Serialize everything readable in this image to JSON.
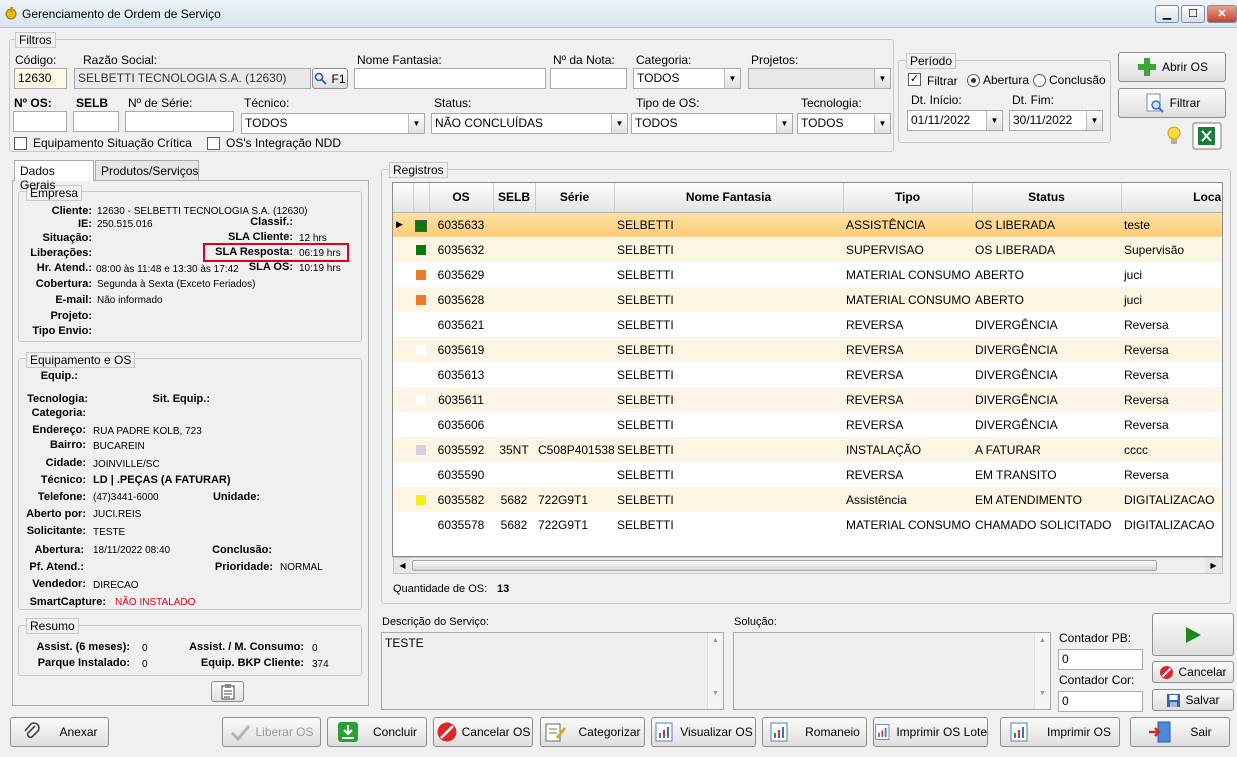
{
  "window": {
    "title": "Gerenciamento de Ordem de Serviço",
    "min_glyph": "▁",
    "max_glyph": "☐",
    "close_glyph": "✕"
  },
  "filters": {
    "legend": "Filtros",
    "codigo": {
      "label": "Código:",
      "value": "12630"
    },
    "razao_social": {
      "label": "Razão Social:",
      "value": "SELBETTI TECNOLOGIA S.A. (12630)"
    },
    "f1_button": "F1",
    "nome_fantasia": {
      "label": "Nome Fantasia:",
      "value": ""
    },
    "nota": {
      "label": "Nº da Nota:",
      "value": ""
    },
    "categoria": {
      "label": "Categoria:",
      "value": "TODOS"
    },
    "projetos": {
      "label": "Projetos:",
      "value": ""
    },
    "num_os": {
      "label": "Nº OS:",
      "value": ""
    },
    "selb": {
      "label": "SELB",
      "value": ""
    },
    "serie": {
      "label": "Nº de Série:",
      "value": ""
    },
    "tecnico": {
      "label": "Técnico:",
      "value": "TODOS"
    },
    "status": {
      "label": "Status:",
      "value": "NÃO CONCLUÍDAS"
    },
    "tipo_os": {
      "label": "Tipo de OS:",
      "value": "TODOS"
    },
    "tecnologia": {
      "label": "Tecnologia:",
      "value": "TODOS"
    },
    "equip_critica": "Equipamento Situação Crítica",
    "integracao_ndd": "OS's Integração NDD"
  },
  "periodo": {
    "legend": "Período",
    "filtrar": "Filtrar",
    "abertura": "Abertura",
    "conclusao": "Conclusão",
    "dt_inicio_label": "Dt. Início:",
    "dt_inicio": "01/11/2022",
    "dt_fim_label": "Dt. Fim:",
    "dt_fim": "30/11/2022"
  },
  "actions": {
    "abrir_os": "Abrir OS",
    "filtrar": "Filtrar"
  },
  "tabs": {
    "dados_gerais": "Dados Gerais",
    "produtos": "Produtos/Serviços"
  },
  "empresa": {
    "legend": "Empresa",
    "cliente_label": "Cliente:",
    "cliente": "12630 - SELBETTI TECNOLOGIA S.A. (12630)",
    "ie_label": "IE:",
    "ie": "250.515.016",
    "classif_label": "Classif.:",
    "situacao_label": "Situação:",
    "sla_cliente_label": "SLA Cliente:",
    "sla_cliente": "12 hrs",
    "liberacoes_label": "Liberações:",
    "sla_resposta_label": "SLA Resposta:",
    "sla_resposta": "06:19 hrs",
    "hr_atend_label": "Hr. Atend.:",
    "hr_atend": "08:00 às 11:48 e 13:30 às 17:42",
    "sla_os_label": "SLA OS:",
    "sla_os": "10:19 hrs",
    "cobertura_label": "Cobertura:",
    "cobertura": "Segunda à Sexta (Exceto Feriados)",
    "email_label": "E-mail:",
    "email": "Não informado",
    "projeto_label": "Projeto:",
    "tipo_envio_label": "Tipo Envio:"
  },
  "equipamento": {
    "legend": "Equipamento e OS",
    "equip_label": "Equip.:",
    "tecnologia_label": "Tecnologia:",
    "sit_equip_label": "Sit. Equip.:",
    "categoria_label": "Categoria:",
    "endereco_label": "Endereço:",
    "endereco": "RUA PADRE KOLB, 723",
    "bairro_label": "Bairro:",
    "bairro": "BUCAREIN",
    "cidade_label": "Cidade:",
    "cidade": "JOINVILLE/SC",
    "tecnico_label": "Técnico:",
    "tecnico": "LD | .PEÇAS (A FATURAR)",
    "telefone_label": "Telefone:",
    "telefone": "(47)3441-6000",
    "unidade_label": "Unidade:",
    "aberto_por_label": "Aberto por:",
    "aberto_por": "JUCI.REIS",
    "solicitante_label": "Solicitante:",
    "solicitante": "TESTE",
    "abertura_label": "Abertura:",
    "abertura": "18/11/2022 08:40",
    "conclusao_label": "Conclusão:",
    "pf_atend_label": "Pf. Atend.:",
    "prioridade_label": "Prioridade:",
    "prioridade": "NORMAL",
    "vendedor_label": "Vendedor:",
    "vendedor": "DIRECAO",
    "smartcapture_label": "SmartCapture:",
    "smartcapture": "NÃO INSTALADO"
  },
  "resumo": {
    "legend": "Resumo",
    "assist_label": "Assist. (6 meses):",
    "assist": "0",
    "assist_consumo_label": "Assist. / M. Consumo:",
    "assist_consumo": "0",
    "parque_label": "Parque Instalado:",
    "parque": "0",
    "bkp_label": "Equip. BKP Cliente:",
    "bkp": "374"
  },
  "registros": {
    "legend": "Registros",
    "columns": [
      "OS",
      "SELB",
      "Série",
      "Nome Fantasia",
      "Tipo",
      "Status",
      "Local"
    ],
    "rows": [
      {
        "os": "6035633",
        "selb": "",
        "serie": "",
        "fantasia": "SELBETTI",
        "tipo": "ASSISTÊNCIA",
        "status": "OS LIBERADA",
        "local": "teste",
        "color": "#0b7a0b"
      },
      {
        "os": "6035632",
        "selb": "",
        "serie": "",
        "fantasia": "SELBETTI",
        "tipo": "SUPERVISAO",
        "status": "OS LIBERADA",
        "local": "Supervisão",
        "color": "#0b7a0b"
      },
      {
        "os": "6035629",
        "selb": "",
        "serie": "",
        "fantasia": "SELBETTI",
        "tipo": "MATERIAL CONSUMO",
        "status": "ABERTO",
        "local": "juci",
        "color": "#f07a2a"
      },
      {
        "os": "6035628",
        "selb": "",
        "serie": "",
        "fantasia": "SELBETTI",
        "tipo": "MATERIAL CONSUMO",
        "status": "ABERTO",
        "local": "juci",
        "color": "#f07a2a"
      },
      {
        "os": "6035621",
        "selb": "",
        "serie": "",
        "fantasia": "SELBETTI",
        "tipo": "REVERSA",
        "status": "DIVERGÊNCIA",
        "local": "Reversa",
        "color": "#ffffff"
      },
      {
        "os": "6035619",
        "selb": "",
        "serie": "",
        "fantasia": "SELBETTI",
        "tipo": "REVERSA",
        "status": "DIVERGÊNCIA",
        "local": "Reversa",
        "color": "#ffffff"
      },
      {
        "os": "6035613",
        "selb": "",
        "serie": "",
        "fantasia": "SELBETTI",
        "tipo": "REVERSA",
        "status": "DIVERGÊNCIA",
        "local": "Reversa",
        "color": "#ffffff"
      },
      {
        "os": "6035611",
        "selb": "",
        "serie": "",
        "fantasia": "SELBETTI",
        "tipo": "REVERSA",
        "status": "DIVERGÊNCIA",
        "local": "Reversa",
        "color": "#ffffff"
      },
      {
        "os": "6035606",
        "selb": "",
        "serie": "",
        "fantasia": "SELBETTI",
        "tipo": "REVERSA",
        "status": "DIVERGÊNCIA",
        "local": "Reversa",
        "color": "#ffffff"
      },
      {
        "os": "6035592",
        "selb": "35NT",
        "serie": "C508P401538",
        "fantasia": "SELBETTI",
        "tipo": "INSTALAÇÃO",
        "status": "A FATURAR",
        "local": "cccc",
        "color": "#d4d4dc"
      },
      {
        "os": "6035590",
        "selb": "",
        "serie": "",
        "fantasia": "SELBETTI",
        "tipo": "REVERSA",
        "status": "EM TRANSITO",
        "local": "Reversa",
        "color": "#ffffff"
      },
      {
        "os": "6035582",
        "selb": "5682",
        "serie": "722G9T1",
        "fantasia": "SELBETTI",
        "tipo": "Assistência",
        "status": "EM ATENDIMENTO",
        "local": "DIGITALIZACAO",
        "color": "#f2ee16"
      },
      {
        "os": "6035578",
        "selb": "5682",
        "serie": "722G9T1",
        "fantasia": "SELBETTI",
        "tipo": "MATERIAL CONSUMO",
        "status": "CHAMADO SOLICITADO",
        "local": "DIGITALIZACAO",
        "color": "#ffffff"
      }
    ],
    "quantidade_label": "Quantidade de OS:",
    "quantidade": "13"
  },
  "descricao": {
    "label": "Descrição do Serviço:",
    "value": "TESTE"
  },
  "solucao": {
    "label": "Solução:",
    "value": ""
  },
  "contador_pb": {
    "label": "Contador PB:",
    "value": "0"
  },
  "contador_cor": {
    "label": "Contador Cor:",
    "value": "0"
  },
  "side_buttons": {
    "cancelar": "Cancelar",
    "salvar": "Salvar"
  },
  "bottom": {
    "anexar": "Anexar",
    "liberar_os": "Liberar OS",
    "concluir": "Concluir",
    "cancelar_os": "Cancelar OS",
    "categorizar": "Categorizar",
    "visualizar_os": "Visualizar OS",
    "romaneio": "Romaneio",
    "imprimir_lote": "Imprimir OS Lote",
    "imprimir_os": "Imprimir OS",
    "sair": "Sair"
  },
  "colors": {
    "accent_selected_row": "#fccd78",
    "alt_row": "#fdf5e4",
    "highlight_box": "#e0001a",
    "smartcapture_text": "#e0001a"
  }
}
